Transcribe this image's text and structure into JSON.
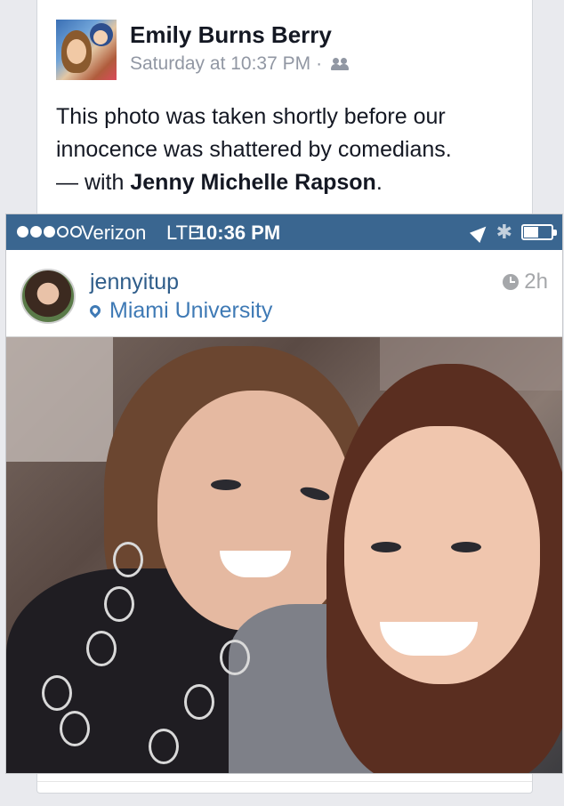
{
  "post": {
    "author": "Emily Burns Berry",
    "timestamp": "Saturday at 10:37 PM",
    "separator": "·",
    "privacy_icon": "friends-icon",
    "text_main": "This photo was taken shortly before our innocence was shattered by comedians.",
    "text_with": "— with",
    "tagged": "Jenny Michelle Rapson",
    "text_end": "."
  },
  "status_bar": {
    "carrier": "Verizon",
    "network": "LTE",
    "time": "10:36 PM",
    "signal_bars_filled": 3,
    "signal_bars_total": 5
  },
  "instagram": {
    "username": "jennyitup",
    "location": "Miami University",
    "age": "2h"
  },
  "colors": {
    "status_bar": "#3a6690",
    "username": "#2f5d8a",
    "location": "#3f7ab5",
    "fb_name": "#141823",
    "fb_meta": "#9197a3"
  }
}
